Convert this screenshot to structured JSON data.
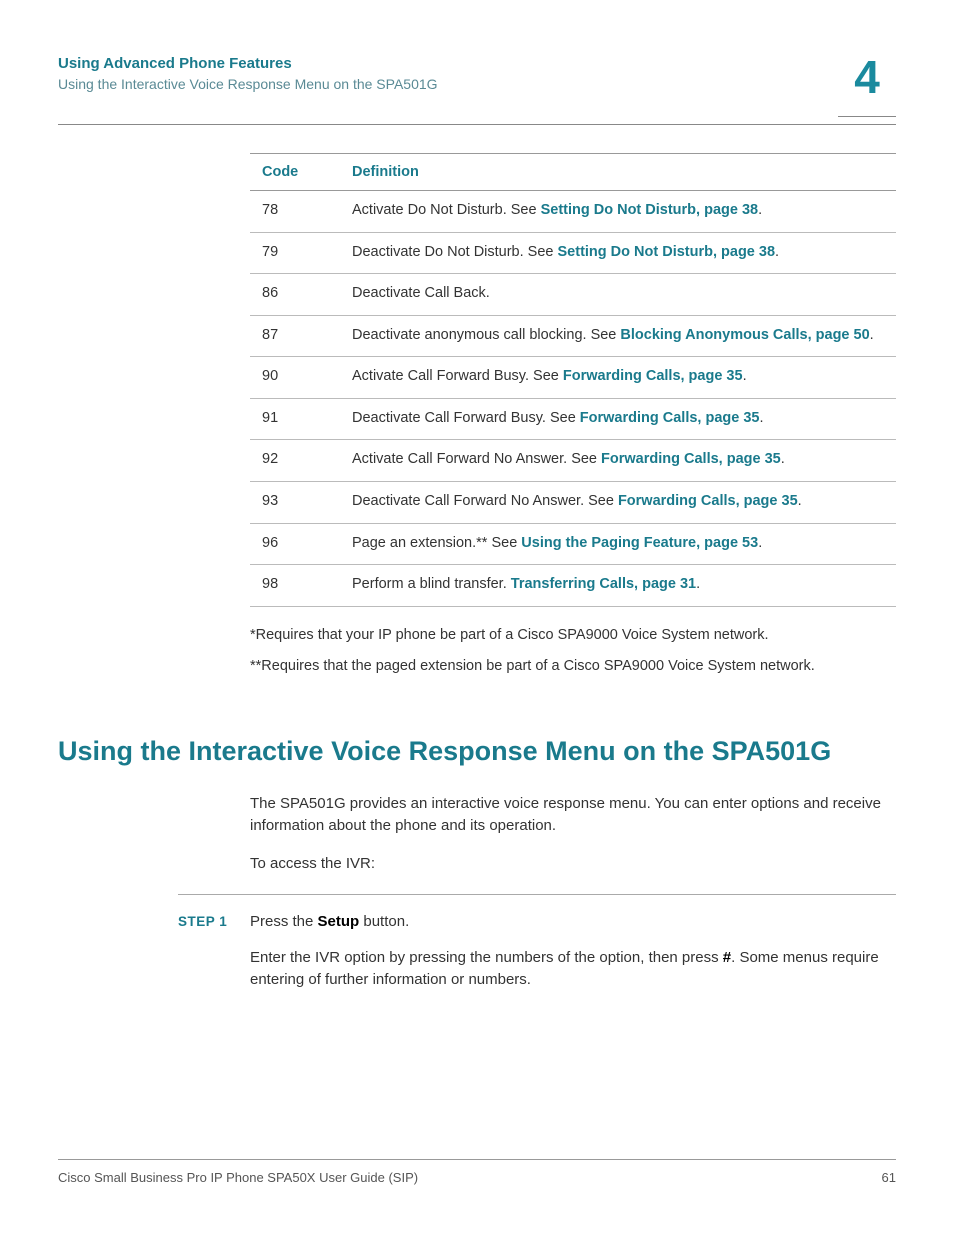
{
  "header": {
    "chapter_title": "Using Advanced Phone Features",
    "breadcrumb": "Using the Interactive Voice Response Menu on the SPA501G",
    "chapter_number": "4"
  },
  "table": {
    "headers": {
      "code": "Code",
      "definition": "Definition"
    },
    "rows": [
      {
        "code": "78",
        "pre": "Activate Do Not Disturb. See ",
        "link": "Setting Do Not Disturb, page 38",
        "post": "."
      },
      {
        "code": "79",
        "pre": "Deactivate Do Not Disturb. See ",
        "link": "Setting Do Not Disturb, page 38",
        "post": "."
      },
      {
        "code": "86",
        "pre": "Deactivate Call Back.",
        "link": "",
        "post": ""
      },
      {
        "code": "87",
        "pre": "Deactivate anonymous call blocking. See ",
        "link": "Blocking Anonymous Calls, page 50",
        "post": "."
      },
      {
        "code": "90",
        "pre": "Activate Call Forward Busy. See ",
        "link": "Forwarding Calls, page 35",
        "post": "."
      },
      {
        "code": "91",
        "pre": "Deactivate Call Forward Busy. See ",
        "link": "Forwarding Calls, page 35",
        "post": "."
      },
      {
        "code": "92",
        "pre": "Activate Call Forward No Answer. See ",
        "link": "Forwarding Calls, page 35",
        "post": "."
      },
      {
        "code": "93",
        "pre": "Deactivate Call Forward No Answer. See ",
        "link": "Forwarding Calls, page 35",
        "post": "."
      },
      {
        "code": "96",
        "pre": "Page an extension.** See ",
        "link": "Using the Paging Feature, page 53",
        "post": "."
      },
      {
        "code": "98",
        "pre": "Perform a blind transfer. ",
        "link": "Transferring Calls, page 31",
        "post": "."
      }
    ]
  },
  "footnotes": {
    "n1": "*Requires that your IP phone be part of a Cisco SPA9000 Voice System network.",
    "n2": "**Requires that the paged extension be part of a Cisco SPA9000 Voice System network."
  },
  "section": {
    "heading": "Using the Interactive Voice Response Menu on the SPA501G",
    "intro": "The SPA501G provides an interactive voice response menu. You can enter options and receive information about the phone and its operation.",
    "access_label": "To access the IVR:",
    "step_label": "STEP  1",
    "step1_pre": "Press the ",
    "step1_bold": "Setup",
    "step1_post": " button.",
    "step1_follow_pre": "Enter the IVR option by pressing the numbers of the option, then press ",
    "step1_follow_bold": "#",
    "step1_follow_post": ". Some menus require entering of further information or numbers."
  },
  "footer": {
    "doc_title": "Cisco Small Business Pro IP Phone SPA50X User Guide (SIP)",
    "page_number": "61"
  }
}
